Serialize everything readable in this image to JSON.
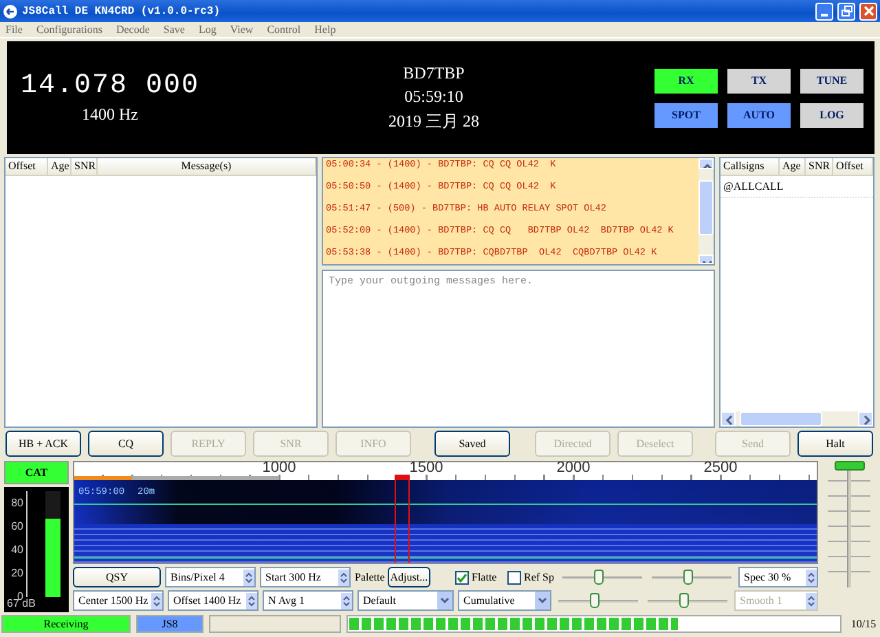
{
  "window": {
    "title": "JS8Call DE KN4CRD (v1.0.0-rc3)"
  },
  "menu": [
    "File",
    "Configurations",
    "Decode",
    "Save",
    "Log",
    "View",
    "Control",
    "Help"
  ],
  "header": {
    "frequency": "14.078 000",
    "offset": "1400 Hz",
    "callsign": "BD7TBP",
    "time": "05:59:10",
    "date": "2019 三月 28",
    "buttons": [
      {
        "label": "RX",
        "color": "#33ff33"
      },
      {
        "label": "TX",
        "color": "#d4d4d4"
      },
      {
        "label": "TUNE",
        "color": "#d4d4d4"
      },
      {
        "label": "SPOT",
        "color": "#6699ff"
      },
      {
        "label": "AUTO",
        "color": "#6699ff"
      },
      {
        "label": "LOG",
        "color": "#d4d4d4"
      }
    ]
  },
  "decodes": {
    "columns": [
      "Offset",
      "Age",
      "SNR",
      "Message(s)"
    ]
  },
  "activity": {
    "messages": [
      "05:00:34 - (1400) - BD7TBP: CQ CQ OL42  K",
      "05:50:50 - (1400) - BD7TBP: CQ CQ OL42  K",
      "05:51:47 - (500) - BD7TBP: HB AUTO RELAY SPOT OL42",
      "05:52:00 - (1400) - BD7TBP: CQ CQ   BD7TBP OL42  BD7TBP OL42 K",
      "05:53:38 - (1400) - BD7TBP: CQBD7TBP  OL42  CQBD7TBP OL42 K"
    ],
    "compose": {
      "placeholder": "Type your outgoing messages here."
    }
  },
  "callsigns": {
    "columns": [
      "Callsigns",
      "Age",
      "SNR",
      "Offset"
    ],
    "rows": [
      "@ALLCALL"
    ]
  },
  "actions": [
    {
      "label": "HB + ACK",
      "disabled": false
    },
    {
      "label": "CQ",
      "disabled": false
    },
    {
      "label": "REPLY",
      "disabled": true
    },
    {
      "label": "SNR",
      "disabled": true
    },
    {
      "label": "INFO",
      "disabled": true
    },
    {
      "label": "Saved",
      "disabled": false
    },
    {
      "label": "Directed",
      "disabled": true
    },
    {
      "label": "Deselect",
      "disabled": true
    },
    {
      "label": "Send",
      "disabled": true
    },
    {
      "label": "Halt",
      "disabled": false
    }
  ],
  "cat": {
    "label": "CAT",
    "level": 0.74,
    "ticks": [
      "80",
      "60",
      "40",
      "20",
      "0"
    ],
    "reading": "67 dB"
  },
  "waterfall": {
    "ruler": [
      "1000",
      "1500",
      "2000",
      "2500"
    ],
    "time": "05:59:00",
    "band": "20m"
  },
  "controls": {
    "row_1": [
      {
        "kind": "button",
        "label": "QSY"
      },
      {
        "kind": "spin",
        "value": "Bins/Pixel  4",
        "disabled": false
      },
      {
        "kind": "spin",
        "value": "Start 300 Hz",
        "disabled": false
      },
      {
        "kind": "palette",
        "label": "Palette",
        "button": "Adjust..."
      },
      {
        "kind": "checkbox",
        "label": "Flatte",
        "checked": true
      },
      {
        "kind": "checkbox",
        "label": "Ref Sp",
        "checked": false
      },
      {
        "kind": "slider",
        "level": 0.45
      },
      {
        "kind": "slider",
        "level": 0.45
      },
      {
        "kind": "spin",
        "value": "Spec 30 %",
        "disabled": false
      }
    ],
    "row_2": [
      {
        "kind": "spin",
        "value": "Center 1500 Hz",
        "disabled": false
      },
      {
        "kind": "spin",
        "value": "Offset 1400 Hz",
        "disabled": false
      },
      {
        "kind": "spin",
        "value": "N Avg 1",
        "disabled": false
      },
      {
        "kind": "combo",
        "value": "Default"
      },
      {
        "kind": "combo",
        "value": "Cumulative"
      },
      {
        "kind": "slider",
        "level": 0.45
      },
      {
        "kind": "slider",
        "level": 0.45
      },
      {
        "kind": "spin",
        "value": "Smooth  1",
        "disabled": true
      }
    ]
  },
  "gain_slider": {
    "level": 1
  },
  "status_bar": {
    "mode": "Receiving",
    "submode": "JS8",
    "progress": {
      "level": 0.67
    },
    "progress_text": "10/15"
  }
}
